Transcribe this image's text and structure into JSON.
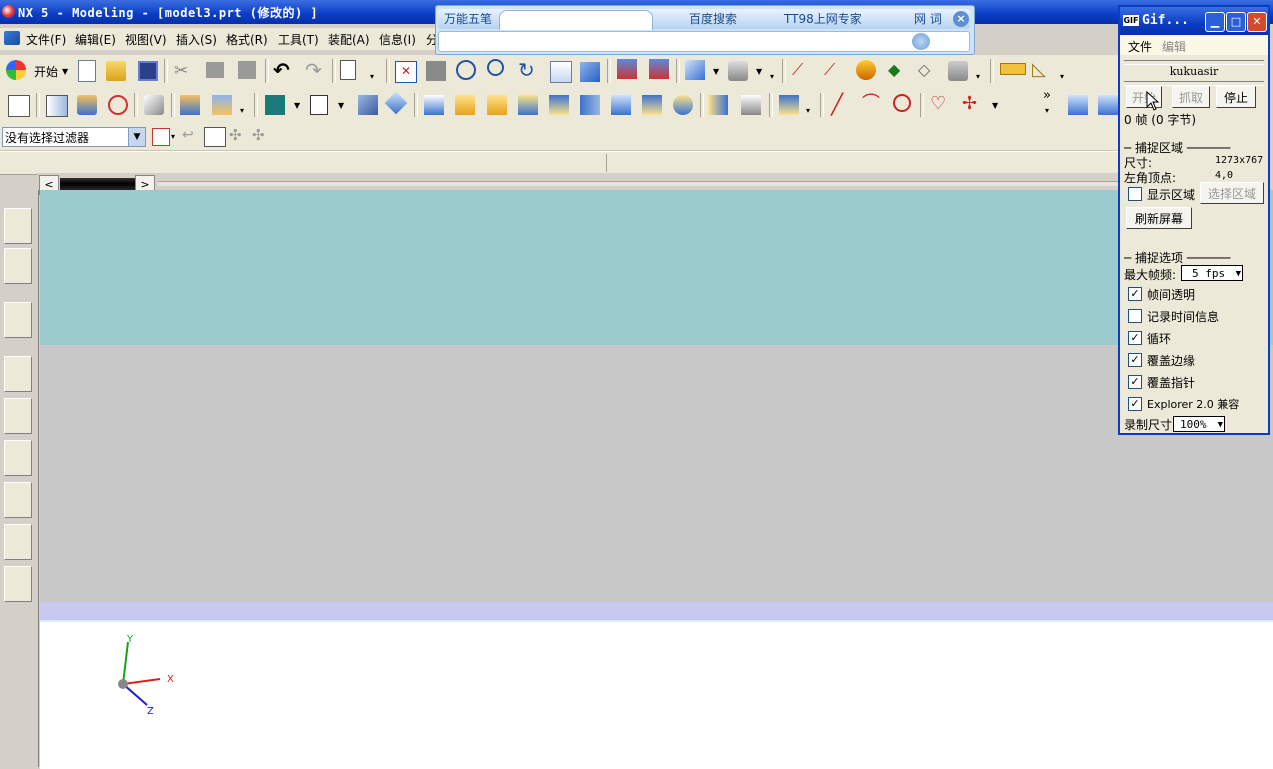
{
  "window": {
    "title": "NX 5 - Modeling - [model3.prt  (修改的) ]"
  },
  "menu": [
    "文件(F)",
    "编辑(E)",
    "视图(V)",
    "插入(S)",
    "格式(R)",
    "工具(T)",
    "装配(A)",
    "信息(I)",
    "分"
  ],
  "ime": {
    "name": "万能五笔",
    "search": "百度搜索",
    "expert": "TT98上网专家",
    "word": "网 词",
    "close": "×"
  },
  "toolbar": {
    "start_label": "开始",
    "more": "»"
  },
  "filter": {
    "value": "没有选择过滤器"
  },
  "graphics": {
    "axis_labels": {
      "x": "X",
      "y": "Y",
      "z": "Z"
    }
  },
  "gif": {
    "title": "Gif...",
    "menu": [
      "文件",
      "编辑"
    ],
    "username": "kukuasir",
    "buttons": {
      "start": "开始",
      "grab": "抓取",
      "stop": "停止"
    },
    "frames_text": "0 帧  (0 字节)",
    "capture_area": {
      "group": "捕捉区域",
      "size_label": "尺寸:",
      "size_value": "1273x767",
      "corner_label": "左角顶点:",
      "corner_value": "4,0",
      "show_region": "显示区域",
      "select_region": "选择区域",
      "refresh": "刷新屏幕"
    },
    "capture_options": {
      "group": "捕捉选项",
      "max_fps_label": "最大帧频:",
      "max_fps_value": "5 fps",
      "options": [
        {
          "label": "帧间透明",
          "checked": true
        },
        {
          "label": "记录时间信息",
          "checked": false
        },
        {
          "label": "循环",
          "checked": true
        },
        {
          "label": "覆盖边缘",
          "checked": true
        },
        {
          "label": "覆盖指针",
          "checked": true
        },
        {
          "label": "Explorer 2.0 兼容",
          "checked": true
        }
      ],
      "record_size_label": "录制尺寸",
      "record_size_value": "100%"
    }
  }
}
